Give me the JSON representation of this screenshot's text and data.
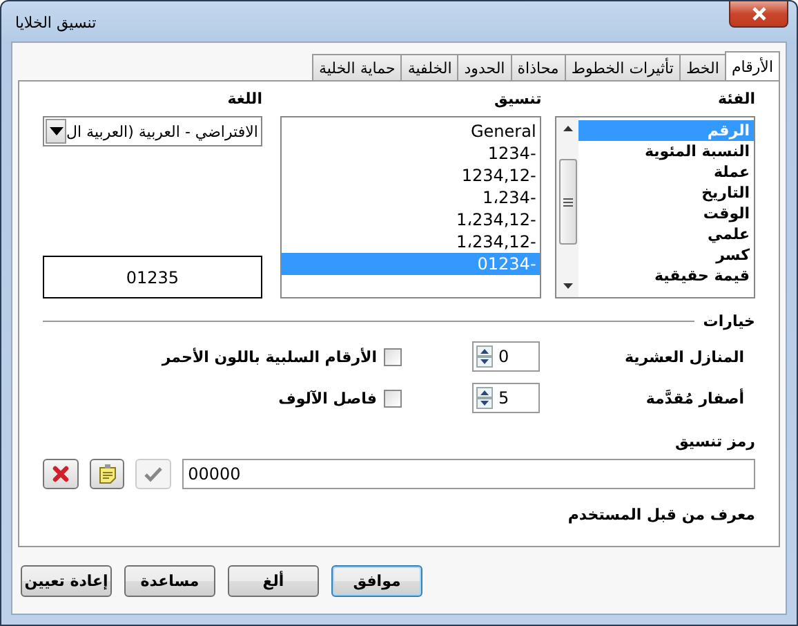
{
  "window": {
    "title": "تنسيق الخلايا"
  },
  "tabs": [
    {
      "label": "الأرقام",
      "selected": true
    },
    {
      "label": "الخط",
      "selected": false
    },
    {
      "label": "تأثيرات الخطوط",
      "selected": false
    },
    {
      "label": "محاذاة",
      "selected": false
    },
    {
      "label": "الحدود",
      "selected": false
    },
    {
      "label": "الخلفية",
      "selected": false
    },
    {
      "label": "حماية الخلية",
      "selected": false
    }
  ],
  "category": {
    "label": "الفئة",
    "items": [
      {
        "label": "الرقم",
        "selected": true
      },
      {
        "label": "النسبة المئوية",
        "selected": false
      },
      {
        "label": "عملة",
        "selected": false
      },
      {
        "label": "التاريخ",
        "selected": false
      },
      {
        "label": "الوقت",
        "selected": false
      },
      {
        "label": "علمي",
        "selected": false
      },
      {
        "label": "كسر",
        "selected": false
      },
      {
        "label": "قيمة حقيقية",
        "selected": false
      }
    ]
  },
  "format": {
    "label": "تنسيق",
    "items": [
      {
        "label": "General",
        "selected": false
      },
      {
        "label": "1234-",
        "selected": false
      },
      {
        "label": "1234,12-",
        "selected": false
      },
      {
        "label": "1،234-",
        "selected": false
      },
      {
        "label": "1،234,12-",
        "selected": false
      },
      {
        "label": "1،234,12-",
        "selected": false
      },
      {
        "label": "01234-",
        "selected": true
      }
    ]
  },
  "language": {
    "label": "اللغة",
    "value": "الافتراضي - العربية (العربية ال"
  },
  "preview": "01235",
  "options": {
    "title": "خيارات",
    "decimal_places": {
      "label": "المنازل العشرية",
      "value": "0"
    },
    "leading_zeros": {
      "label": "أصفار مُقدَّمة",
      "value": "5"
    },
    "negative_red": {
      "label": "الأرقام السلبية باللون الأحمر",
      "checked": false
    },
    "thousands_separator": {
      "label": "فاصل الآلوف",
      "checked": false
    }
  },
  "format_code": {
    "label": "رمز تنسيق",
    "value": "00000",
    "buttons": [
      {
        "kind": "accept",
        "disabled": true
      },
      {
        "kind": "comment",
        "disabled": false
      },
      {
        "kind": "delete",
        "disabled": false
      }
    ]
  },
  "user_defined_label": "معرف من قبل المستخدم",
  "buttons": [
    {
      "label": "موافق",
      "default": true
    },
    {
      "label": "ألغ",
      "default": false
    },
    {
      "label": "مساعدة",
      "default": false
    },
    {
      "label": "إعادة تعيين",
      "default": false
    }
  ]
}
